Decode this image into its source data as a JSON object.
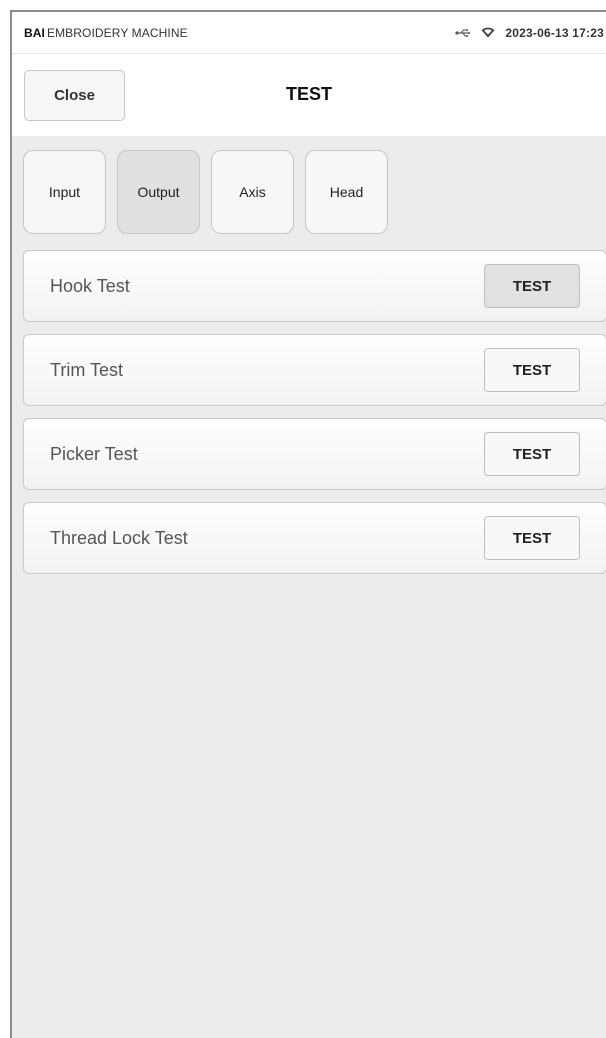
{
  "statusbar": {
    "brand_bold": "BAI",
    "brand_rest": "EMBROIDERY MACHINE",
    "datetime": "2023-06-13 17:23",
    "icons": [
      "usb-icon",
      "wifi-icon"
    ]
  },
  "header": {
    "close_label": "Close",
    "title": "TEST"
  },
  "tabs": [
    {
      "label": "Input",
      "active": false
    },
    {
      "label": "Output",
      "active": true
    },
    {
      "label": "Axis",
      "active": false
    },
    {
      "label": "Head",
      "active": false
    }
  ],
  "tests": [
    {
      "label": "Hook Test",
      "button": "TEST",
      "pressed": true
    },
    {
      "label": "Trim Test",
      "button": "TEST",
      "pressed": false
    },
    {
      "label": "Picker Test",
      "button": "TEST",
      "pressed": false
    },
    {
      "label": "Thread Lock Test",
      "button": "TEST",
      "pressed": false
    }
  ],
  "colors": {
    "background": "#ebecee",
    "active_tab": "#dfe0e2"
  }
}
